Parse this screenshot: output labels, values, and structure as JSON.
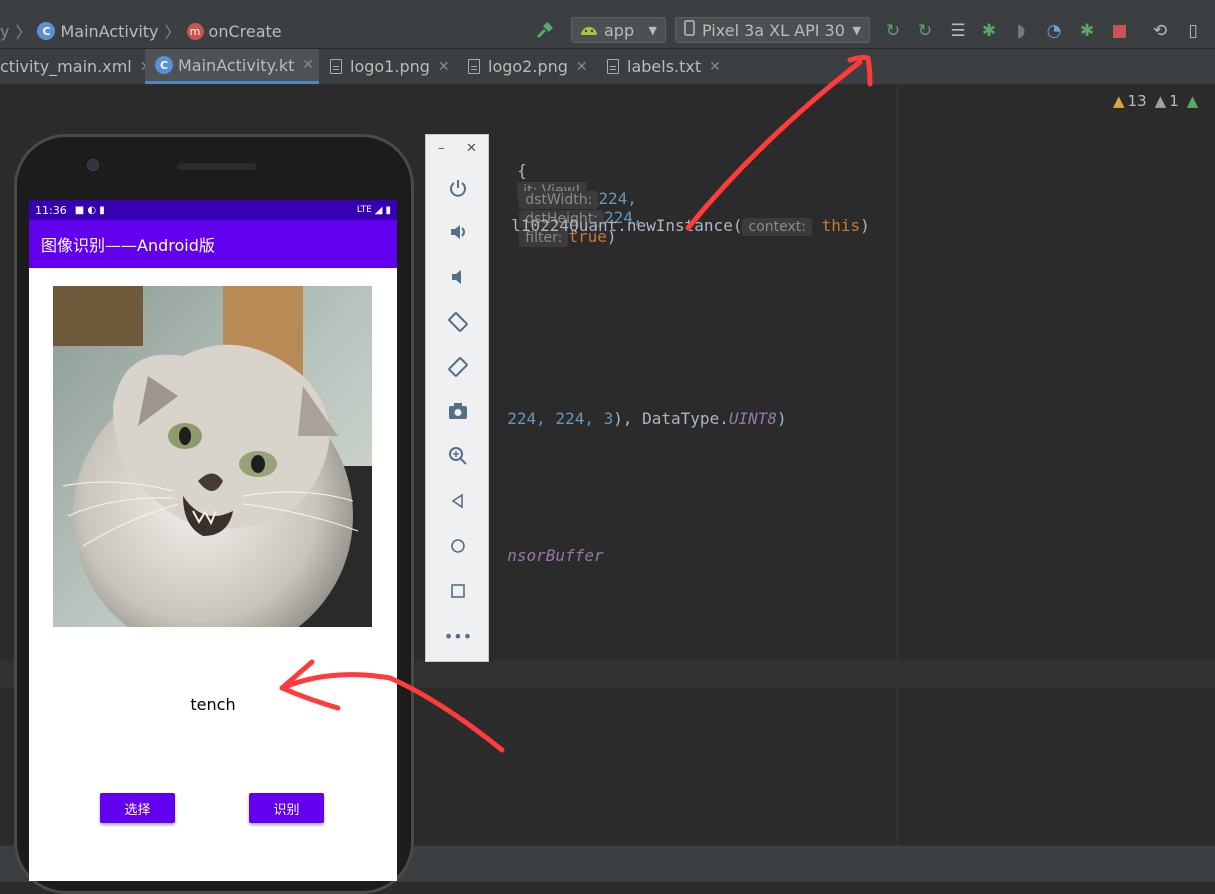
{
  "toolbar": {
    "breadcrumb": [
      {
        "label": "MainActivity",
        "icon": "kotlin-class-icon"
      },
      {
        "label": "onCreate",
        "icon": "method-icon"
      }
    ],
    "config_label": "app",
    "device_label": "Pixel 3a XL API 30"
  },
  "tabs": [
    {
      "label": "ctivity_main.xml"
    },
    {
      "label": "MainActivity.kt"
    },
    {
      "label": "logo1.png"
    },
    {
      "label": "logo2.png"
    },
    {
      "label": "labels.txt"
    }
  ],
  "inspections": {
    "warnings": "13",
    "weak_warnings": "1"
  },
  "code": {
    "line1_brace": "{",
    "line1_hint": "it: View!",
    "hint_dst_width": "dstWidth:",
    "val_dst_width": "224,",
    "hint_dst_height": "dstHeight:",
    "val_dst_height": "224,",
    "hint_filter": "filter:",
    "val_filter": "true",
    "line3": "l10224Quant.newInstance(",
    "hint_context": "context:",
    "val_context": "this",
    "line_shape_nums": "224, 224, 3",
    "line_shape_tail": "), DataType.",
    "line_shape_type": "UINT8",
    "line_tensor": "nsorBuffer"
  },
  "emulator_controls": [
    "power-icon",
    "volume-up-icon",
    "volume-down-icon",
    "rotate-left-icon",
    "rotate-right-icon",
    "camera-icon",
    "zoom-icon",
    "back-icon",
    "home-icon",
    "overview-icon",
    "more-icon"
  ],
  "phone": {
    "time": "11:36",
    "network": "LTE",
    "app_title": "图像识别——Android版",
    "result_text": "tench",
    "select_button": "选择",
    "recognize_button": "识别"
  },
  "colors": {
    "primary": "#6200ee",
    "status_bar": "#3700b3",
    "annotation": "#ff3b3b"
  }
}
